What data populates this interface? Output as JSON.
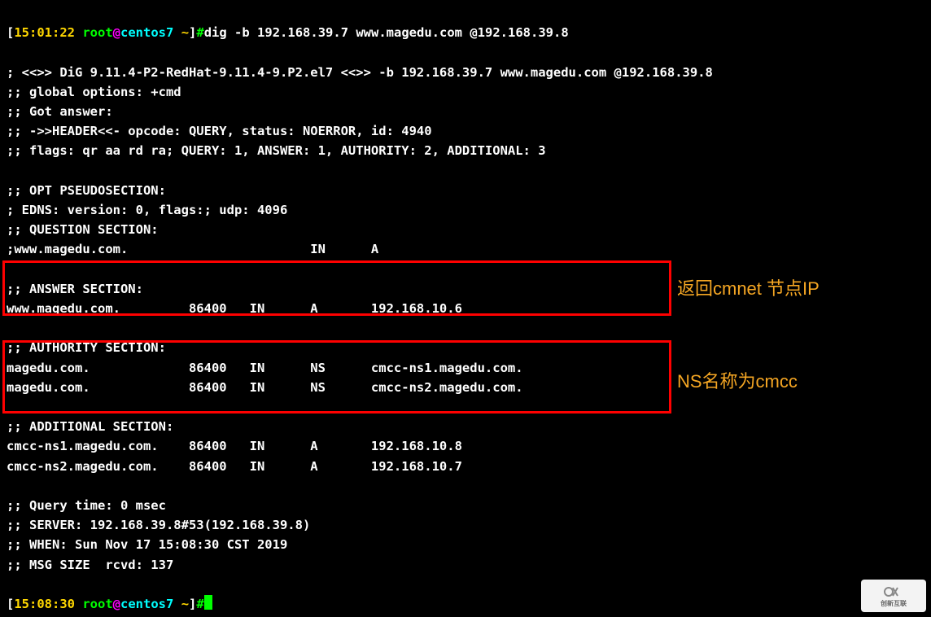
{
  "prompt1": {
    "time": "15:01:22",
    "user": "root",
    "host": "centos7",
    "path": "~",
    "symbol": "#",
    "command": "dig -b 192.168.39.7 www.magedu.com @192.168.39.8"
  },
  "dig_banner": "; <<>> DiG 9.11.4-P2-RedHat-9.11.4-9.P2.el7 <<>> -b 192.168.39.7 www.magedu.com @192.168.39.8",
  "global_options": ";; global options: +cmd",
  "got_answer": ";; Got answer:",
  "header_line": ";; ->>HEADER<<- opcode: QUERY, status: NOERROR, id: 4940",
  "flags_line": ";; flags: qr aa rd ra; QUERY: 1, ANSWER: 1, AUTHORITY: 2, ADDITIONAL: 3",
  "opt_header": ";; OPT PSEUDOSECTION:",
  "edns_line": "; EDNS: version: 0, flags:; udp: 4096",
  "question_header": ";; QUESTION SECTION:",
  "question_row": ";www.magedu.com.                        IN      A",
  "answer_header": ";; ANSWER SECTION:",
  "answer_row": "www.magedu.com.         86400   IN      A       192.168.10.6",
  "authority_header": ";; AUTHORITY SECTION:",
  "authority_row1": "magedu.com.             86400   IN      NS      cmcc-ns1.magedu.com.",
  "authority_row2": "magedu.com.             86400   IN      NS      cmcc-ns2.magedu.com.",
  "additional_header": ";; ADDITIONAL SECTION:",
  "additional_row1": "cmcc-ns1.magedu.com.    86400   IN      A       192.168.10.8",
  "additional_row2": "cmcc-ns2.magedu.com.    86400   IN      A       192.168.10.7",
  "query_time": ";; Query time: 0 msec",
  "server_line": ";; SERVER: 192.168.39.8#53(192.168.39.8)",
  "when_line": ";; WHEN: Sun Nov 17 15:08:30 CST 2019",
  "msg_size": ";; MSG SIZE  rcvd: 137",
  "prompt2": {
    "time": "15:08:30",
    "user": "root",
    "host": "centos7",
    "path": "~",
    "symbol": "#"
  },
  "annotation1": "返回cmnet 节点IP",
  "annotation2": "NS名称为cmcc",
  "logo_text": "创新互联"
}
